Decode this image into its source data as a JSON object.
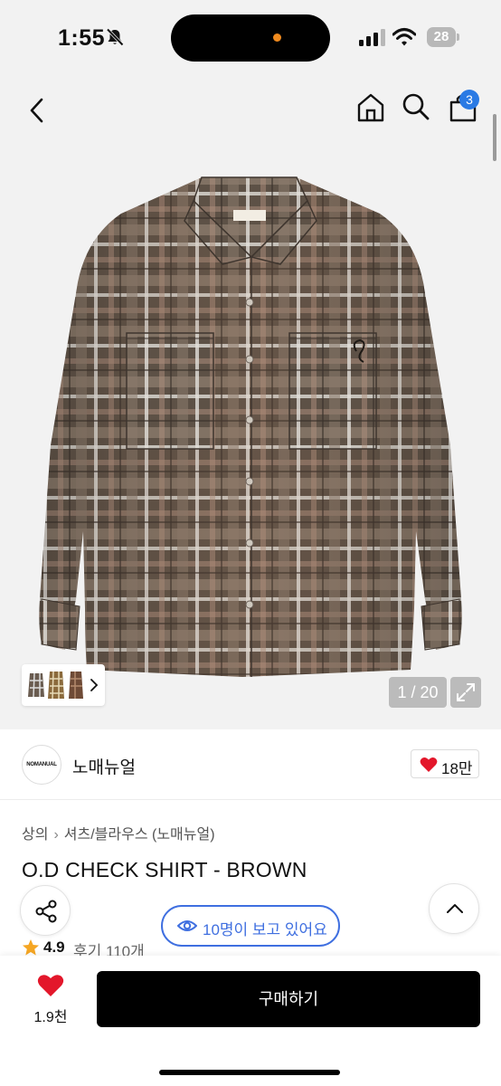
{
  "status_bar": {
    "time": "1:55",
    "battery": "28",
    "icons": [
      "silent-bell-icon",
      "signal-icon",
      "wifi-icon",
      "battery-icon"
    ],
    "island_dot_color": "#f08a1e"
  },
  "nav": {
    "icons": [
      "back-icon",
      "home-icon",
      "search-icon",
      "cart-icon"
    ],
    "cart_badge": "3",
    "badge_color": "#2a7ae4"
  },
  "gallery": {
    "counter": "1 / 20",
    "icons": [
      "thumbnail-next-icon",
      "expand-icon"
    ]
  },
  "brand": {
    "logo_text": "NOMANUAL",
    "name": "노매뉴얼",
    "like_count": "18만"
  },
  "product": {
    "breadcrumb": [
      "상의",
      "셔츠/블라우스 (노매뉴얼)"
    ],
    "title": "O.D CHECK SHIRT - BROWN",
    "viewers": "10명이 보고 있어요",
    "rating": "4.9",
    "reviews": "후기 110개"
  },
  "bottom": {
    "wish_count": "1.9천",
    "buy_label": "구매하기"
  },
  "colors": {
    "accent_blue": "#3f6fe0",
    "heart_red": "#e3172b",
    "star": "#f5a623"
  }
}
